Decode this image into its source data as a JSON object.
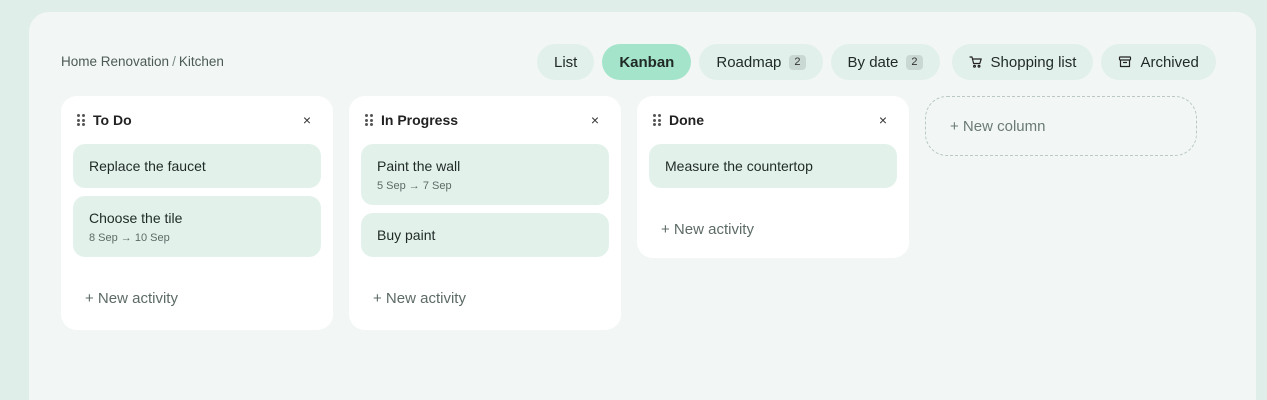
{
  "breadcrumb": {
    "project": "Home Renovation",
    "separator": "/",
    "page": "Kitchen"
  },
  "toolbar": {
    "tabs": [
      {
        "label": "List"
      },
      {
        "label": "Kanban",
        "active": true
      },
      {
        "label": "Roadmap",
        "count": "2"
      },
      {
        "label": "By date",
        "count": "2"
      }
    ],
    "shopping": {
      "label": "Shopping list",
      "icon": "cart-icon"
    },
    "archived": {
      "label": "Archived",
      "icon": "archive-icon"
    }
  },
  "columns": [
    {
      "title": "To Do",
      "cards": [
        {
          "title": "Replace the faucet"
        },
        {
          "title": "Choose the tile",
          "date": "8 Sep → 10 Sep"
        }
      ],
      "new_label": "+ New activity"
    },
    {
      "title": "In Progress",
      "cards": [
        {
          "title": "Paint the wall",
          "date": "5 Sep → 7 Sep"
        },
        {
          "title": "Buy paint"
        }
      ],
      "new_label": "+ New activity"
    },
    {
      "title": "Done",
      "cards": [
        {
          "title": "Measure the countertop"
        }
      ],
      "new_label": "+ New activity"
    }
  ],
  "new_column_label": "+ New column",
  "close_glyph": "×",
  "colors": {
    "background": "#e0eeea",
    "panel": "#f2f7f5",
    "active_tab": "#a4e4cb",
    "card": "#e2f2eb"
  }
}
